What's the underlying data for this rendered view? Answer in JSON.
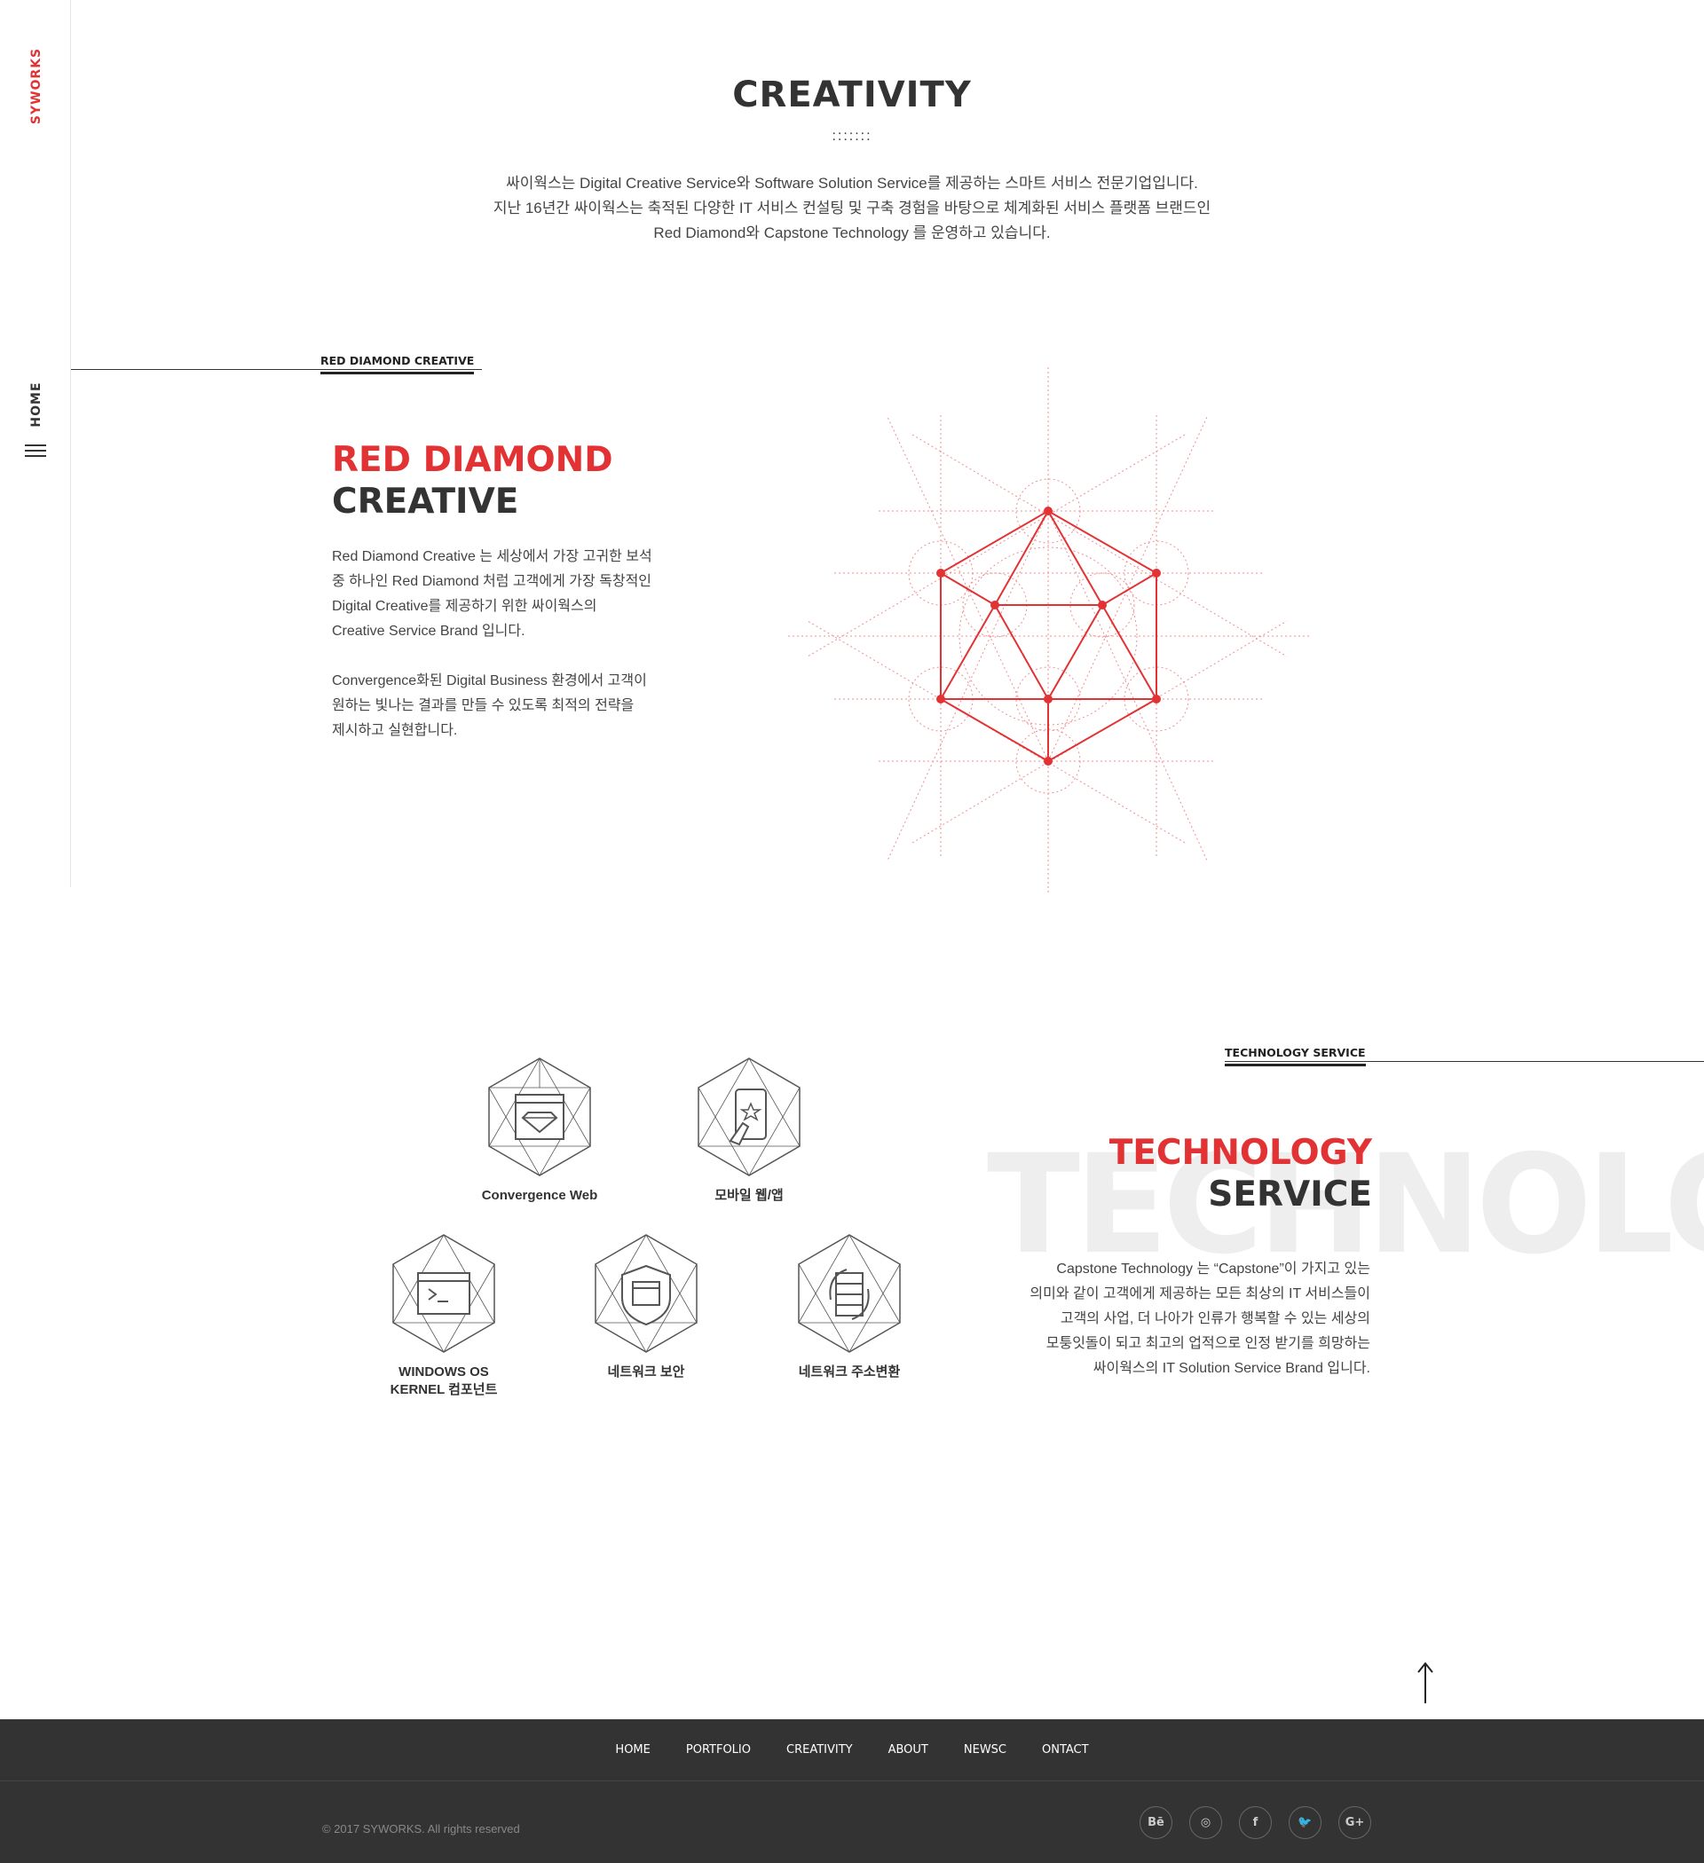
{
  "sidebar": {
    "logo": "SYWORKS",
    "home_label": "HOME"
  },
  "creativity": {
    "title": "CREATIVITY",
    "dots": ":::::::",
    "intro_1": "싸이웍스는 Digital Creative Service와 Software Solution Service를 제공하는 스마트 서비스 전문기업입니다.",
    "intro_2": "지난 16년간 싸이웍스는 축적된 다양한 IT 서비스 컨설팅 및 구축 경험을 바탕으로 체계화된 서비스 플랫폼 브랜드인",
    "intro_3": "Red Diamond와 Capstone Technology 를 운영하고 있습니다."
  },
  "red_diamond": {
    "label": "RED DIAMOND CREATIVE",
    "title_red": "RED DIAMOND",
    "title_dark": "CREATIVE",
    "paragraph_1": "Red Diamond Creative 는 세상에서 가장 고귀한 보석\n중 하나인 Red Diamond 처럼 고객에게 가장 독창적인\nDigital Creative를 제공하기 위한 싸이웍스의\nCreative Service Brand 입니다.",
    "paragraph_2": "Convergence화된 Digital Business 환경에서 고객이\n원하는 빛나는 결과를 만들 수 있도록 최적의 전략을\n제시하고 실현합니다."
  },
  "technology": {
    "label": "TECHNOLOGY SERVICE",
    "ghost_text": "TECHNOLO",
    "title_red": "TECHNOLOGY",
    "title_dark": "SERVICE",
    "body": "Capstone Technology 는 “Capstone”이 가지고 있는\n의미와 같이 고객에게 제공하는 모든 최상의 IT 서비스들이\n고객의 사업, 더 나아가 인류가 행복할 수 있는 세상의\n모퉁잇돌이 되고 최고의 업적으로 인정 받기를 희망하는\n싸이웍스의 IT Solution Service Brand 입니다.",
    "services": [
      {
        "label": "Convergence Web",
        "icon": "diamond-browser-icon"
      },
      {
        "label": "모바일 웹/앱",
        "icon": "mobile-app-icon"
      },
      {
        "label": "WINDOWS OS\nKERNEL 컴포넌트",
        "icon": "terminal-window-icon"
      },
      {
        "label": "네트워크 보안",
        "icon": "shield-icon"
      },
      {
        "label": "네트워크 주소변환",
        "icon": "server-sync-icon"
      }
    ]
  },
  "footer": {
    "nav": [
      "HOME",
      "PORTFOLIO",
      "CREATIVITY",
      "ABOUT",
      "NEWSC",
      "ONTACT"
    ],
    "copyright": "© 2017 SYWORKS.  All rights reserved",
    "socials": [
      {
        "name": "behance-icon",
        "glyph": "Bē"
      },
      {
        "name": "dribbble-icon",
        "glyph": "◎"
      },
      {
        "name": "facebook-icon",
        "glyph": "f"
      },
      {
        "name": "twitter-icon",
        "glyph": "🐦"
      },
      {
        "name": "google-plus-icon",
        "glyph": "G+"
      }
    ]
  },
  "colors": {
    "accent": "#e23234",
    "dark": "#333333",
    "footer_bg": "#333333",
    "ghost": "#eeeeee"
  }
}
